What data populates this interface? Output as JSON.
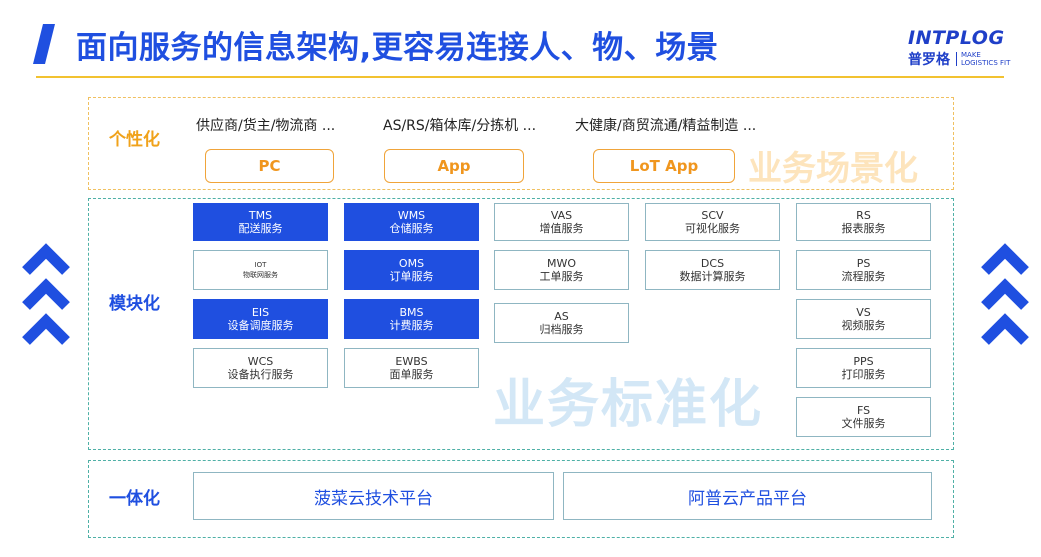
{
  "header": {
    "title": "面向服务的信息架构,更容易连接人、物、场景",
    "logo": {
      "name": "INTPLOG",
      "name_cn": "普罗格",
      "slogan": "MAKE\nLOGISTICS FIT"
    }
  },
  "layers": {
    "personalization": {
      "label": "个性化",
      "watermark": "业务场景化",
      "actors": [
        "供应商/货主/物流商 ...",
        "AS/RS/箱体库/分拣机 ...",
        "大健康/商贸流通/精益制造 ..."
      ],
      "channels": [
        "PC",
        "App",
        "LoT App"
      ]
    },
    "modularization": {
      "label": "模块化",
      "watermark": "业务标准化",
      "services": [
        {
          "code": "TMS",
          "name": "配送服务",
          "style": "filled"
        },
        {
          "code": "IOT",
          "name": "物联网服务",
          "style": "small"
        },
        {
          "code": "EIS",
          "name": "设备调度服务",
          "style": "filled"
        },
        {
          "code": "WCS",
          "name": "设备执行服务",
          "style": "outline"
        },
        {
          "code": "WMS",
          "name": "仓储服务",
          "style": "filled"
        },
        {
          "code": "OMS",
          "name": "订单服务",
          "style": "filled"
        },
        {
          "code": "BMS",
          "name": "计费服务",
          "style": "filled"
        },
        {
          "code": "EWBS",
          "name": "面单服务",
          "style": "outline"
        },
        {
          "code": "VAS",
          "name": "增值服务",
          "style": "outline"
        },
        {
          "code": "MWO",
          "name": "工单服务",
          "style": "outline"
        },
        {
          "code": "AS",
          "name": "归档服务",
          "style": "outline"
        },
        {
          "code": "SCV",
          "name": "可视化服务",
          "style": "outline"
        },
        {
          "code": "DCS",
          "name": "数据计算服务",
          "style": "outline"
        },
        {
          "code": "RS",
          "name": "报表服务",
          "style": "outline"
        },
        {
          "code": "PS",
          "name": "流程服务",
          "style": "outline"
        },
        {
          "code": "VS",
          "name": "视频服务",
          "style": "outline"
        },
        {
          "code": "PPS",
          "name": "打印服务",
          "style": "outline"
        },
        {
          "code": "FS",
          "name": "文件服务",
          "style": "outline"
        }
      ]
    },
    "integration": {
      "label": "一体化",
      "platforms": [
        "菠菜云技术平台",
        "阿普云产品平台"
      ]
    }
  },
  "colors": {
    "primary": "#1f4fe0",
    "orange": "#f0a21a",
    "title_rule": "#f2c230",
    "watermark_blue": "#d3e7f6",
    "watermark_orange": "#fde4bc",
    "border_teal": "#4fb0a6"
  },
  "icons": {
    "side_arrows": "triple-chevron-up-icon"
  }
}
